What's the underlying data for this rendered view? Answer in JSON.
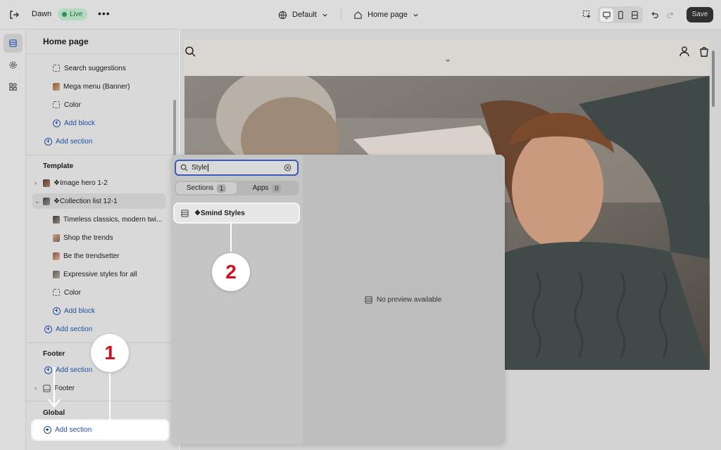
{
  "topbar": {
    "store_name": "Dawn",
    "status_badge": "Live",
    "more_label": "•••",
    "theme_label": "Default",
    "page_label": "Home page",
    "save_label": "Save"
  },
  "sidebar": {
    "title": "Home page",
    "header_items": [
      {
        "label": "Search suggestions",
        "icon": "dashed-block-icon"
      },
      {
        "label": "Mega menu (Banner)",
        "icon": "image-thumbnail-icon"
      },
      {
        "label": "Color",
        "icon": "dashed-block-icon"
      }
    ],
    "header_add_block": "Add block",
    "header_add_section": "Add section",
    "template_heading": "Template",
    "template_sections": [
      {
        "label": "❖Image hero 1-2",
        "expanded": false
      },
      {
        "label": "❖Collection list 12-1",
        "expanded": true
      }
    ],
    "collection_blocks": [
      {
        "label": "Timeless classics, modern twi..."
      },
      {
        "label": "Shop the trends"
      },
      {
        "label": "Be the trendsetter"
      },
      {
        "label": "Expressive styles for all"
      },
      {
        "label": "Color"
      }
    ],
    "template_add_block": "Add block",
    "template_add_section": "Add section",
    "footer_heading": "Footer",
    "footer_add_section": "Add section",
    "footer_item": "Footer",
    "global_heading": "Global",
    "global_add_section": "Add section"
  },
  "popup": {
    "search_value": "Style",
    "tabs": [
      {
        "label": "Sections",
        "count": "1",
        "active": true
      },
      {
        "label": "Apps",
        "count": "0",
        "active": false
      }
    ],
    "result_label": "❖Smind Styles",
    "no_preview": "No preview available"
  },
  "callouts": {
    "step1": "1",
    "step2": "2"
  },
  "colors": {
    "accent_blue": "#1d4f9c",
    "callout_red": "#d0101f",
    "live_green": "#2f8f57"
  }
}
